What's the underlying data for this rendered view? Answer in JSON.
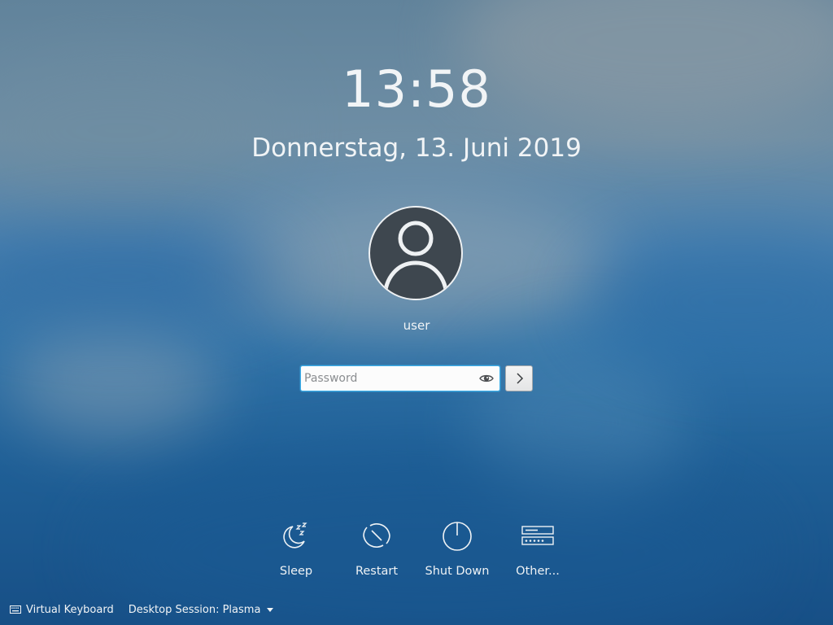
{
  "clock": {
    "time": "13:58",
    "date": "Donnerstag, 13. Juni 2019"
  },
  "user": {
    "name": "user",
    "avatar_icon": "user-avatar-icon"
  },
  "password": {
    "placeholder": "Password",
    "value": "",
    "reveal_icon": "eye-icon",
    "submit_icon": "chevron-right-icon"
  },
  "actions": [
    {
      "label": "Sleep",
      "icon": "sleep-icon"
    },
    {
      "label": "Restart",
      "icon": "restart-icon"
    },
    {
      "label": "Shut Down",
      "icon": "power-icon"
    },
    {
      "label": "Other...",
      "icon": "server-icon"
    }
  ],
  "footer": {
    "virtual_keyboard": "Virtual Keyboard",
    "virtual_keyboard_icon": "keyboard-icon",
    "session": "Desktop Session: Plasma",
    "session_icon": "caret-down-icon"
  },
  "colors": {
    "accent": "#3daee9",
    "text": "#f1f4f6",
    "avatar_bg": "#3e474f"
  }
}
